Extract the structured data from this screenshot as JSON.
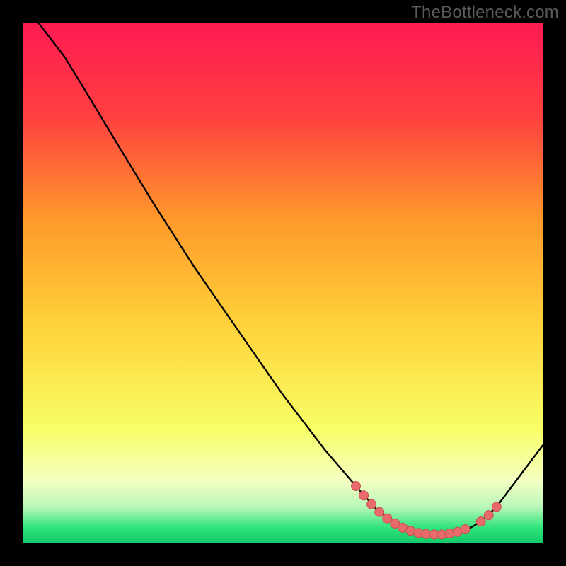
{
  "watermark": "TheBottleneck.com",
  "colors": {
    "bg": "#000000",
    "watermark": "#5b5b5b",
    "curve": "#000000",
    "dot_fill": "#e86a6a",
    "dot_stroke": "#c94f4f",
    "grad_top": "#ff1a52",
    "grad_upper": "#ff6a3a",
    "grad_mid": "#ffd23a",
    "grad_lower": "#f8ff66",
    "grad_pale": "#f4ffc2",
    "grad_green1": "#a4f7a4",
    "grad_green2": "#2fe47a",
    "grad_green3": "#11c96a"
  },
  "chart_data": {
    "type": "line",
    "title": "",
    "xlabel": "",
    "ylabel": "",
    "xlim": [
      0,
      100
    ],
    "ylim": [
      0,
      100
    ],
    "curve": [
      {
        "x": 0,
        "y": 103
      },
      {
        "x": 3,
        "y": 100
      },
      {
        "x": 8,
        "y": 93.5
      },
      {
        "x": 12,
        "y": 87
      },
      {
        "x": 18,
        "y": 77
      },
      {
        "x": 25,
        "y": 65.5
      },
      {
        "x": 33,
        "y": 53
      },
      {
        "x": 42,
        "y": 40
      },
      {
        "x": 50,
        "y": 28.5
      },
      {
        "x": 58,
        "y": 18
      },
      {
        "x": 64,
        "y": 11
      },
      {
        "x": 68,
        "y": 6.5
      },
      {
        "x": 72,
        "y": 3.4
      },
      {
        "x": 75,
        "y": 2.2
      },
      {
        "x": 78,
        "y": 1.8
      },
      {
        "x": 82,
        "y": 1.8
      },
      {
        "x": 85,
        "y": 2.4
      },
      {
        "x": 88,
        "y": 4.2
      },
      {
        "x": 91,
        "y": 7
      },
      {
        "x": 94,
        "y": 11
      },
      {
        "x": 97,
        "y": 15
      },
      {
        "x": 100,
        "y": 19
      }
    ],
    "dots": [
      {
        "x": 64,
        "y": 11.0
      },
      {
        "x": 65.5,
        "y": 9.2
      },
      {
        "x": 67,
        "y": 7.5
      },
      {
        "x": 68.5,
        "y": 6.0
      },
      {
        "x": 70,
        "y": 4.8
      },
      {
        "x": 71.5,
        "y": 3.8
      },
      {
        "x": 73,
        "y": 3.0
      },
      {
        "x": 74.5,
        "y": 2.4
      },
      {
        "x": 76,
        "y": 2.0
      },
      {
        "x": 77.5,
        "y": 1.8
      },
      {
        "x": 79,
        "y": 1.7
      },
      {
        "x": 80.5,
        "y": 1.7
      },
      {
        "x": 82,
        "y": 1.9
      },
      {
        "x": 83.5,
        "y": 2.2
      },
      {
        "x": 85,
        "y": 2.7
      },
      {
        "x": 88,
        "y": 4.2
      },
      {
        "x": 89.5,
        "y": 5.4
      },
      {
        "x": 91,
        "y": 7.0
      }
    ]
  }
}
